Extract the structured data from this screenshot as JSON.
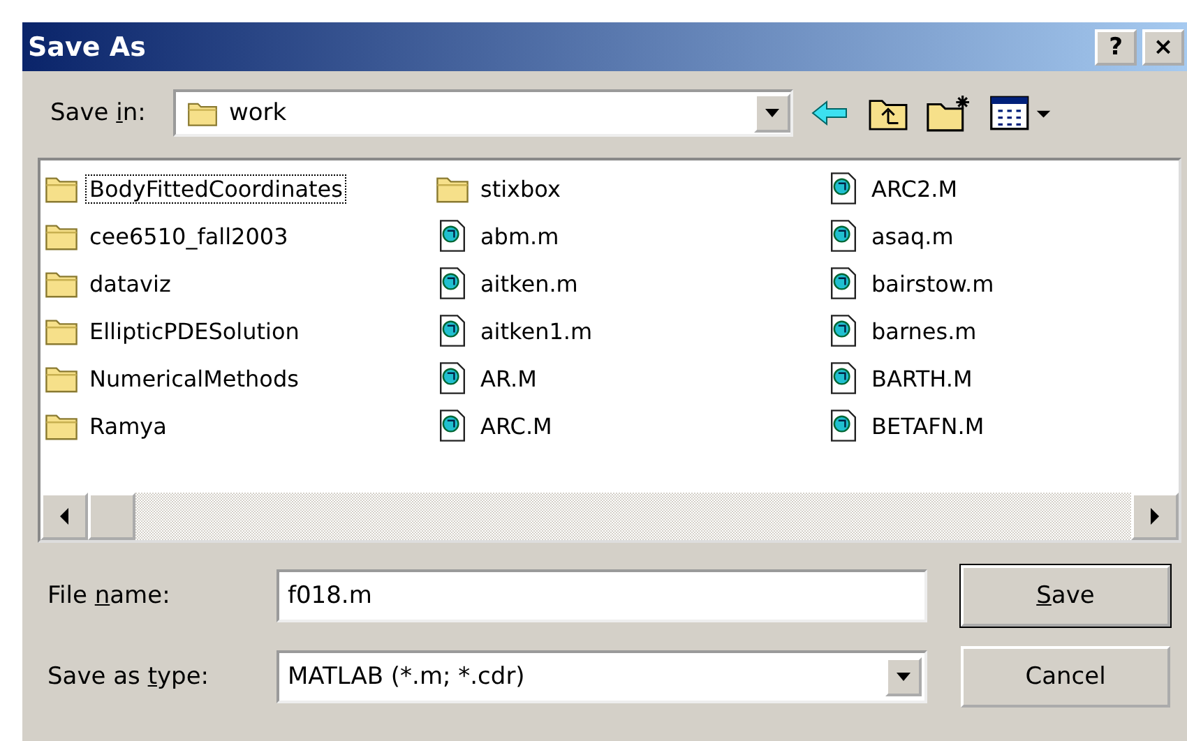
{
  "window": {
    "title": "Save As",
    "buttons": [
      {
        "kind": "help",
        "label": "?"
      },
      {
        "kind": "close",
        "label": "×"
      }
    ]
  },
  "save_in": {
    "label": {
      "pre": "Save ",
      "key": "i",
      "post": "n:"
    },
    "value": "work"
  },
  "files": [
    {
      "name": "BodyFittedCoordinates",
      "kind": "folder",
      "focused": true
    },
    {
      "name": "cee6510_fall2003",
      "kind": "folder",
      "focused": false
    },
    {
      "name": "dataviz",
      "kind": "folder",
      "focused": false
    },
    {
      "name": "EllipticPDESolution",
      "kind": "folder",
      "focused": false
    },
    {
      "name": "NumericalMethods",
      "kind": "folder",
      "focused": false
    },
    {
      "name": "Ramya",
      "kind": "folder",
      "focused": false
    },
    {
      "name": "stixbox",
      "kind": "folder",
      "focused": false
    },
    {
      "name": "abm.m",
      "kind": "file",
      "focused": false
    },
    {
      "name": "aitken.m",
      "kind": "file",
      "focused": false
    },
    {
      "name": "aitken1.m",
      "kind": "file",
      "focused": false
    },
    {
      "name": "AR.M",
      "kind": "file",
      "focused": false
    },
    {
      "name": "ARC.M",
      "kind": "file",
      "focused": false
    },
    {
      "name": "ARC2.M",
      "kind": "file",
      "focused": false
    },
    {
      "name": "asaq.m",
      "kind": "file",
      "focused": false
    },
    {
      "name": "bairstow.m",
      "kind": "file",
      "focused": false
    },
    {
      "name": "barnes.m",
      "kind": "file",
      "focused": false
    },
    {
      "name": "BARTH.M",
      "kind": "file",
      "focused": false
    },
    {
      "name": "BETAFN.M",
      "kind": "file",
      "focused": false
    }
  ],
  "file_name": {
    "label": {
      "pre": "File ",
      "key": "n",
      "post": "ame:"
    },
    "value": "f018.m"
  },
  "save_as_type": {
    "label": {
      "pre": "Save as ",
      "key": "t",
      "post": "ype:"
    },
    "value": "MATLAB (*.m; *.cdr)"
  },
  "buttons": [
    {
      "label": {
        "key": "S",
        "post": "ave"
      },
      "default": true
    },
    {
      "label": {
        "pre": "Cancel"
      },
      "default": false
    }
  ]
}
